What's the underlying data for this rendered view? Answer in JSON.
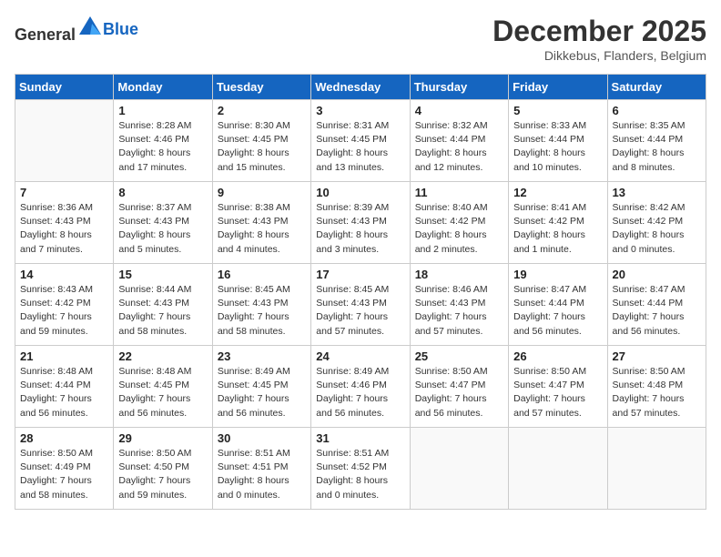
{
  "header": {
    "logo_general": "General",
    "logo_blue": "Blue",
    "month": "December 2025",
    "location": "Dikkebus, Flanders, Belgium"
  },
  "weekdays": [
    "Sunday",
    "Monday",
    "Tuesday",
    "Wednesday",
    "Thursday",
    "Friday",
    "Saturday"
  ],
  "weeks": [
    [
      {
        "day": "",
        "info": ""
      },
      {
        "day": "1",
        "info": "Sunrise: 8:28 AM\nSunset: 4:46 PM\nDaylight: 8 hours\nand 17 minutes."
      },
      {
        "day": "2",
        "info": "Sunrise: 8:30 AM\nSunset: 4:45 PM\nDaylight: 8 hours\nand 15 minutes."
      },
      {
        "day": "3",
        "info": "Sunrise: 8:31 AM\nSunset: 4:45 PM\nDaylight: 8 hours\nand 13 minutes."
      },
      {
        "day": "4",
        "info": "Sunrise: 8:32 AM\nSunset: 4:44 PM\nDaylight: 8 hours\nand 12 minutes."
      },
      {
        "day": "5",
        "info": "Sunrise: 8:33 AM\nSunset: 4:44 PM\nDaylight: 8 hours\nand 10 minutes."
      },
      {
        "day": "6",
        "info": "Sunrise: 8:35 AM\nSunset: 4:44 PM\nDaylight: 8 hours\nand 8 minutes."
      }
    ],
    [
      {
        "day": "7",
        "info": "Sunrise: 8:36 AM\nSunset: 4:43 PM\nDaylight: 8 hours\nand 7 minutes."
      },
      {
        "day": "8",
        "info": "Sunrise: 8:37 AM\nSunset: 4:43 PM\nDaylight: 8 hours\nand 5 minutes."
      },
      {
        "day": "9",
        "info": "Sunrise: 8:38 AM\nSunset: 4:43 PM\nDaylight: 8 hours\nand 4 minutes."
      },
      {
        "day": "10",
        "info": "Sunrise: 8:39 AM\nSunset: 4:43 PM\nDaylight: 8 hours\nand 3 minutes."
      },
      {
        "day": "11",
        "info": "Sunrise: 8:40 AM\nSunset: 4:42 PM\nDaylight: 8 hours\nand 2 minutes."
      },
      {
        "day": "12",
        "info": "Sunrise: 8:41 AM\nSunset: 4:42 PM\nDaylight: 8 hours\nand 1 minute."
      },
      {
        "day": "13",
        "info": "Sunrise: 8:42 AM\nSunset: 4:42 PM\nDaylight: 8 hours\nand 0 minutes."
      }
    ],
    [
      {
        "day": "14",
        "info": "Sunrise: 8:43 AM\nSunset: 4:42 PM\nDaylight: 7 hours\nand 59 minutes."
      },
      {
        "day": "15",
        "info": "Sunrise: 8:44 AM\nSunset: 4:43 PM\nDaylight: 7 hours\nand 58 minutes."
      },
      {
        "day": "16",
        "info": "Sunrise: 8:45 AM\nSunset: 4:43 PM\nDaylight: 7 hours\nand 58 minutes."
      },
      {
        "day": "17",
        "info": "Sunrise: 8:45 AM\nSunset: 4:43 PM\nDaylight: 7 hours\nand 57 minutes."
      },
      {
        "day": "18",
        "info": "Sunrise: 8:46 AM\nSunset: 4:43 PM\nDaylight: 7 hours\nand 57 minutes."
      },
      {
        "day": "19",
        "info": "Sunrise: 8:47 AM\nSunset: 4:44 PM\nDaylight: 7 hours\nand 56 minutes."
      },
      {
        "day": "20",
        "info": "Sunrise: 8:47 AM\nSunset: 4:44 PM\nDaylight: 7 hours\nand 56 minutes."
      }
    ],
    [
      {
        "day": "21",
        "info": "Sunrise: 8:48 AM\nSunset: 4:44 PM\nDaylight: 7 hours\nand 56 minutes."
      },
      {
        "day": "22",
        "info": "Sunrise: 8:48 AM\nSunset: 4:45 PM\nDaylight: 7 hours\nand 56 minutes."
      },
      {
        "day": "23",
        "info": "Sunrise: 8:49 AM\nSunset: 4:45 PM\nDaylight: 7 hours\nand 56 minutes."
      },
      {
        "day": "24",
        "info": "Sunrise: 8:49 AM\nSunset: 4:46 PM\nDaylight: 7 hours\nand 56 minutes."
      },
      {
        "day": "25",
        "info": "Sunrise: 8:50 AM\nSunset: 4:47 PM\nDaylight: 7 hours\nand 56 minutes."
      },
      {
        "day": "26",
        "info": "Sunrise: 8:50 AM\nSunset: 4:47 PM\nDaylight: 7 hours\nand 57 minutes."
      },
      {
        "day": "27",
        "info": "Sunrise: 8:50 AM\nSunset: 4:48 PM\nDaylight: 7 hours\nand 57 minutes."
      }
    ],
    [
      {
        "day": "28",
        "info": "Sunrise: 8:50 AM\nSunset: 4:49 PM\nDaylight: 7 hours\nand 58 minutes."
      },
      {
        "day": "29",
        "info": "Sunrise: 8:50 AM\nSunset: 4:50 PM\nDaylight: 7 hours\nand 59 minutes."
      },
      {
        "day": "30",
        "info": "Sunrise: 8:51 AM\nSunset: 4:51 PM\nDaylight: 8 hours\nand 0 minutes."
      },
      {
        "day": "31",
        "info": "Sunrise: 8:51 AM\nSunset: 4:52 PM\nDaylight: 8 hours\nand 0 minutes."
      },
      {
        "day": "",
        "info": ""
      },
      {
        "day": "",
        "info": ""
      },
      {
        "day": "",
        "info": ""
      }
    ]
  ]
}
